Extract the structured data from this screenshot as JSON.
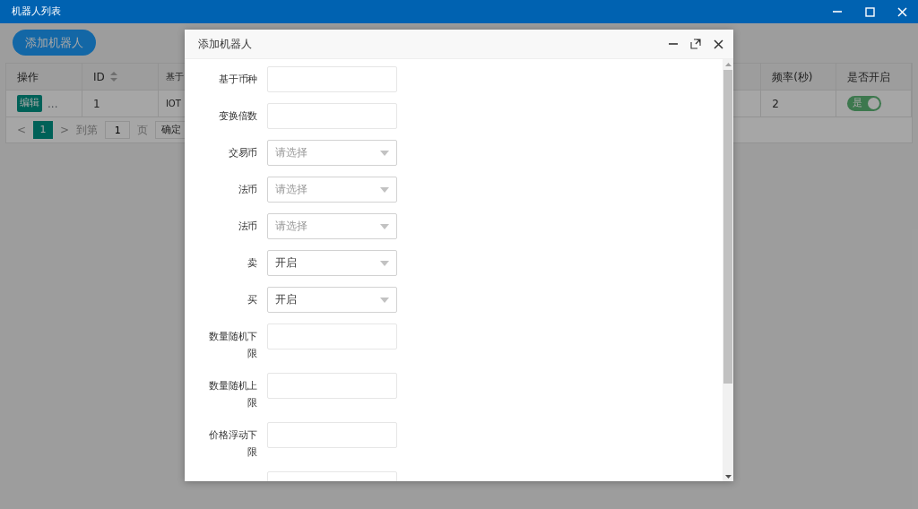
{
  "window": {
    "title": "机器人列表"
  },
  "add_button": "添加机器人",
  "table": {
    "columns": [
      {
        "label": "操作",
        "sortable": false
      },
      {
        "label": "ID",
        "sortable": true
      },
      {
        "label": "基于"
      },
      {
        "label": "频率(秒)",
        "sortable": false
      },
      {
        "label": "是否开启",
        "sortable": false
      }
    ],
    "rows": [
      {
        "action": "编辑",
        "more": "...",
        "id": "1",
        "base": "IOT",
        "frequency": "2",
        "enabled": true,
        "enabled_label": "是"
      }
    ]
  },
  "pagination": {
    "prev": "<",
    "pages": [
      {
        "label": "1",
        "selected": true
      }
    ],
    "next": ">",
    "goto_label": "到第",
    "goto_value": "1",
    "page_label": "页",
    "confirm": "确定"
  },
  "dialog": {
    "title": "添加机器人",
    "fields": [
      {
        "label": "基于币种",
        "kind": "input"
      },
      {
        "label": "变换倍数",
        "kind": "input"
      },
      {
        "label": "交易币",
        "kind": "select",
        "placeholder": "请选择"
      },
      {
        "label": "法币",
        "kind": "select",
        "placeholder": "请选择"
      },
      {
        "label": "法币",
        "kind": "select",
        "placeholder": "请选择"
      },
      {
        "label": "卖",
        "kind": "select",
        "value": "开启"
      },
      {
        "label": "买",
        "kind": "select",
        "value": "开启"
      },
      {
        "label": "数量随机下限",
        "kind": "input"
      },
      {
        "label": "数量随机上限",
        "kind": "input"
      },
      {
        "label": "价格浮动下限",
        "kind": "input"
      },
      {
        "kind": "input"
      }
    ]
  }
}
